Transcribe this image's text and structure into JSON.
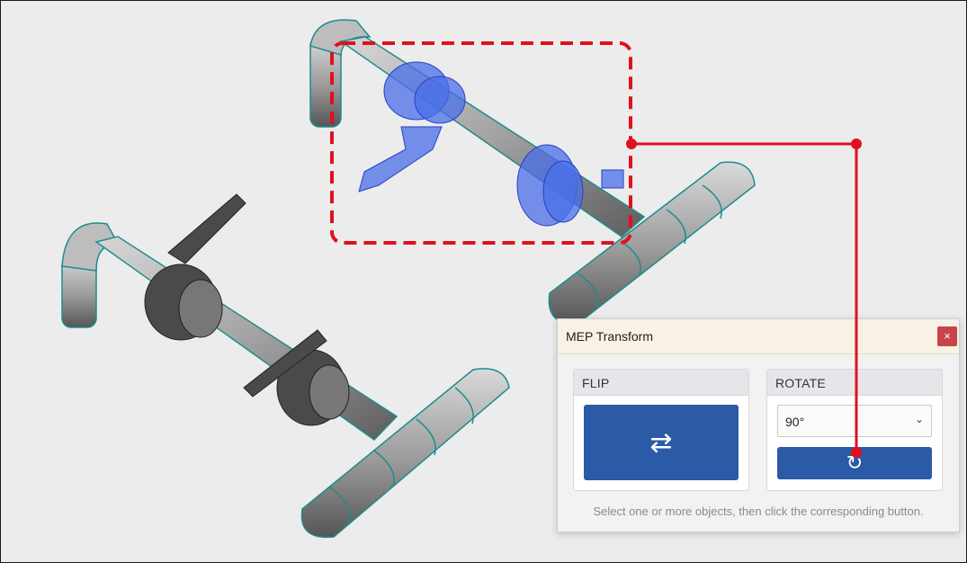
{
  "colors": {
    "annotation": "#e0101e",
    "accent": "#2b5aa6",
    "selection": "#3b5fe0",
    "pipe": "#9a9a9a",
    "pipe_edge": "#1e8c8c",
    "close": "#c9444a"
  },
  "dialog": {
    "title": "MEP Transform",
    "close_icon": "×",
    "flip": {
      "heading": "FLIP",
      "icon": "⇄",
      "icon_name": "flip-arrows-icon"
    },
    "rotate": {
      "heading": "ROTATE",
      "selected_angle": "90°",
      "chevron": "⌄",
      "icon": "↻",
      "icon_name": "rotate-icon"
    },
    "hint": "Select one or more objects, then click the corresponding button."
  }
}
